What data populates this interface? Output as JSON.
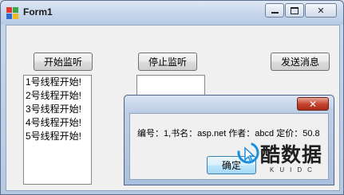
{
  "window": {
    "title": "Form1"
  },
  "buttons": {
    "start_monitor": "开始监听",
    "stop_monitor": "停止监听",
    "send_message": "发送消息"
  },
  "thread_list": [
    "1号线程开始!",
    "2号线程开始!",
    "3号线程开始!",
    "4号线程开始!",
    "5号线程开始!"
  ],
  "textbox": {
    "value": ""
  },
  "message_box": {
    "text": "编号：1,书名：asp.net 作者：abcd 定价：50.8",
    "ok_label": "确定"
  },
  "watermark": {
    "name": "酷数据",
    "sub": "KUIDC"
  },
  "colors": {
    "watermark_blue": "#1c8fe0",
    "close_red": "#c4402b"
  }
}
